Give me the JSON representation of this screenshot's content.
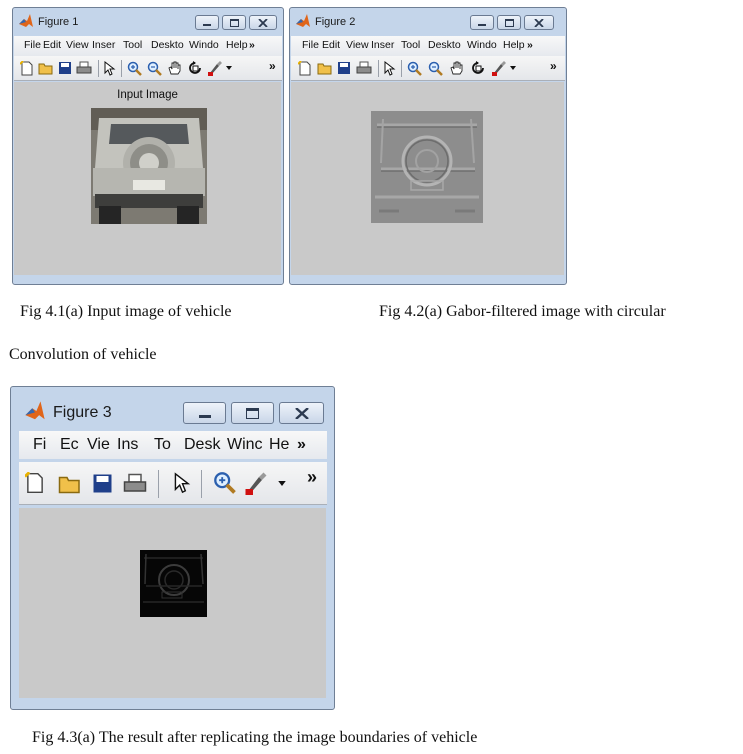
{
  "figure1": {
    "title": "Figure 1",
    "menu": [
      "File",
      "Edit",
      "View",
      "Inser",
      "Tool",
      "Deskto",
      "Windo",
      "Help"
    ],
    "menu_overflow": "»",
    "toolbar_overflow": "»",
    "axes_title": "Input Image"
  },
  "figure2": {
    "title": "Figure 2",
    "menu": [
      "File",
      "Edit",
      "View",
      "Inser",
      "Tool",
      "Deskto",
      "Windo",
      "Help"
    ],
    "menu_overflow": "»",
    "toolbar_overflow": "»"
  },
  "figure3": {
    "title": "Figure 3",
    "menu": [
      "Fi",
      "Ec",
      "Vie",
      "Ins",
      "To",
      "Desk",
      "Winc",
      "He"
    ],
    "menu_overflow": "»",
    "toolbar_overflow": "»"
  },
  "captions": {
    "fig41": "Fig 4.1(a) Input image of vehicle",
    "fig42": "Fig 4.2(a) Gabor-filtered image with circular",
    "fig42_cont": "Convolution of vehicle",
    "fig43": "Fig 4.3(a) The result after replicating the image boundaries of vehicle"
  },
  "colors": {
    "frame": "#c4d5ea",
    "figure_bg": "#c9c9c9",
    "matlab_orange": "#e0651a"
  }
}
